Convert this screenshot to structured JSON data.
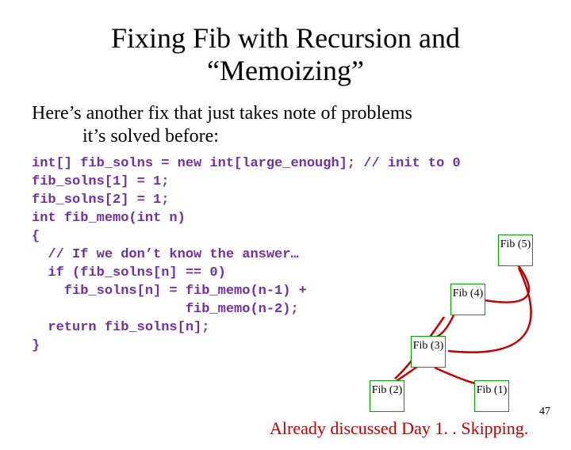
{
  "title_line1": "Fixing Fib with Recursion and",
  "title_line2": "“Memoizing”",
  "intro_line1": "Here’s another fix that just takes note of problems",
  "intro_line2": "it’s solved before:",
  "code": "int[] fib_solns = new int[large_enough]; // init to 0\nfib_solns[1] = 1;\nfib_solns[2] = 1;\nint fib_memo(int n)\n{\n  // If we don’t know the answer…\n  if (fib_solns[n] == 0)\n    fib_solns[n] = fib_memo(n-1) +\n                   fib_memo(n-2);\n  return fib_solns[n];\n}",
  "nodes": {
    "fib5": "Fib\n(5)",
    "fib4": "Fib\n(4)",
    "fib3": "Fib\n(3)",
    "fib2": "Fib\n(2)",
    "fib1": "Fib\n(1)"
  },
  "caption": "Already discussed Day 1. . Skipping.",
  "pagenum": "47"
}
